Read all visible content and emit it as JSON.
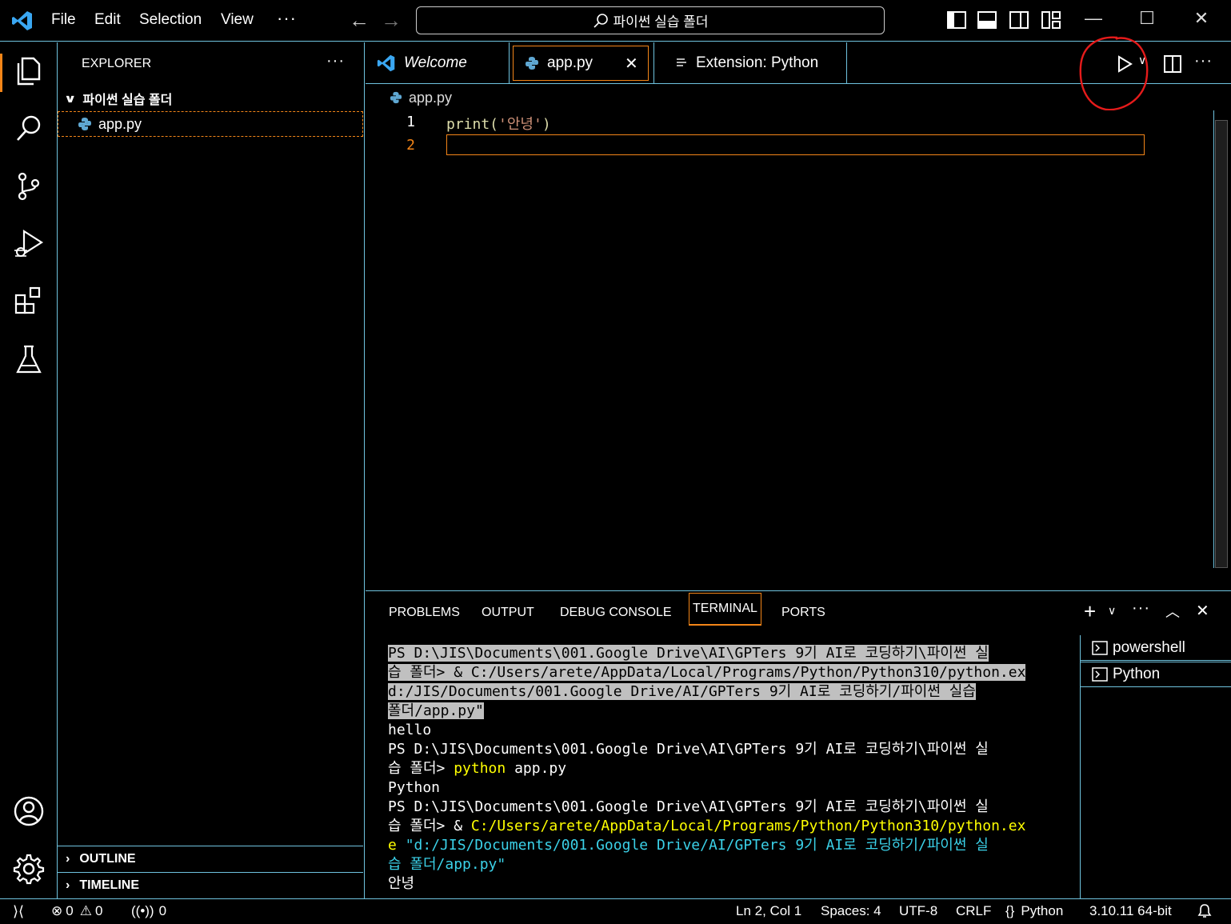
{
  "menu": [
    "File",
    "Edit",
    "Selection",
    "View",
    "···"
  ],
  "search": {
    "text": "파이썬 실습 폴더"
  },
  "sidebar": {
    "title": "EXPLORER",
    "more": "···",
    "folder": "파이썬 실습 폴더",
    "file": "app.py",
    "outline": "OUTLINE",
    "timeline": "TIMELINE"
  },
  "tabs": [
    {
      "label": "Welcome"
    },
    {
      "label": "app.py",
      "close": "✕"
    },
    {
      "label": "Extension: Python"
    }
  ],
  "breadcrumb": "app.py",
  "editor": {
    "lines": [
      {
        "num": "1",
        "fn": "print(",
        "str": "'안녕'",
        "end": ")"
      },
      {
        "num": "2"
      }
    ]
  },
  "panel": {
    "tabs": [
      "PROBLEMS",
      "OUTPUT",
      "DEBUG CONSOLE",
      "TERMINAL",
      "PORTS"
    ],
    "terminals": [
      "powershell",
      "Python"
    ],
    "term_lines": [
      "PS D:\\JIS\\Documents\\001.Google Drive\\AI\\GPTers 9기 AI로 코딩하기\\파이썬 실",
      "습 폴더> & C:/Users/arete/AppData/Local/Programs/Python/Python310/python.ex",
      "d:/JIS/Documents/001.Google Drive/AI/GPTers 9기 AI로 코딩하기/파이썬 실습",
      "폴더/app.py\"",
      "hello",
      "PS D:\\JIS\\Documents\\001.Google Drive\\AI\\GPTers 9기 AI로 코딩하기\\파이썬 실",
      "습 폴더> ",
      "python",
      " app.py",
      "Python",
      "PS D:\\JIS\\Documents\\001.Google Drive\\AI\\GPTers 9기 AI로 코딩하기\\파이썬 실",
      "습 폴더> & ",
      "C:/Users/arete/AppData/Local/Programs/Python/Python310/python.ex",
      "e ",
      "\"d:/JIS/Documents/001.Google Drive/AI/GPTers 9기 AI로 코딩하기/파이썬 실",
      "습 폴더/app.py\"",
      "안녕"
    ]
  },
  "status": {
    "errors": "0",
    "warnings": "0",
    "ports": "0",
    "position": "Ln 2, Col 1",
    "spaces": "Spaces: 4",
    "encoding": "UTF-8",
    "eol": "CRLF",
    "language": "Python",
    "interpreter": "3.10.11 64-bit"
  },
  "colors": {
    "contrast_border": "#6fc3df",
    "focus_border": "#f38518",
    "vscode_blue": "#3aa7f2",
    "annotation_red": "#e51b1b"
  }
}
